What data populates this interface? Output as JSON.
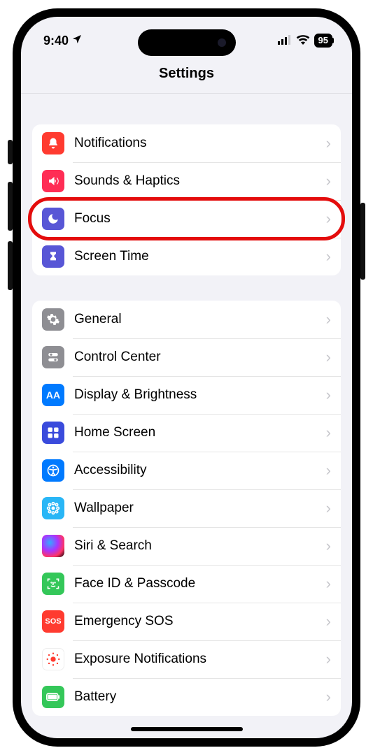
{
  "status": {
    "time": "9:40",
    "battery": "95"
  },
  "header": {
    "title": "Settings"
  },
  "groups": [
    {
      "items": [
        {
          "key": "notifications",
          "label": "Notifications"
        },
        {
          "key": "sounds-haptics",
          "label": "Sounds & Haptics"
        },
        {
          "key": "focus",
          "label": "Focus",
          "highlighted": true
        },
        {
          "key": "screen-time",
          "label": "Screen Time"
        }
      ]
    },
    {
      "items": [
        {
          "key": "general",
          "label": "General"
        },
        {
          "key": "control-center",
          "label": "Control Center"
        },
        {
          "key": "display-brightness",
          "label": "Display & Brightness"
        },
        {
          "key": "home-screen",
          "label": "Home Screen"
        },
        {
          "key": "accessibility",
          "label": "Accessibility"
        },
        {
          "key": "wallpaper",
          "label": "Wallpaper"
        },
        {
          "key": "siri-search",
          "label": "Siri & Search"
        },
        {
          "key": "face-id-passcode",
          "label": "Face ID & Passcode"
        },
        {
          "key": "emergency-sos",
          "label": "Emergency SOS"
        },
        {
          "key": "exposure-notifications",
          "label": "Exposure Notifications"
        },
        {
          "key": "battery",
          "label": "Battery"
        }
      ]
    }
  ],
  "icons": {
    "notifications": {
      "bg": "#ff3b30",
      "glyph": "bell"
    },
    "sounds-haptics": {
      "bg": "#ff2d55",
      "glyph": "speaker"
    },
    "focus": {
      "bg": "#5856d6",
      "glyph": "moon"
    },
    "screen-time": {
      "bg": "#5856d6",
      "glyph": "hourglass"
    },
    "general": {
      "bg": "#8e8e93",
      "glyph": "gear"
    },
    "control-center": {
      "bg": "#8e8e93",
      "glyph": "toggles"
    },
    "display-brightness": {
      "bg": "#007aff",
      "glyph": "AA"
    },
    "home-screen": {
      "bg": "#3355dd",
      "glyph": "grid"
    },
    "accessibility": {
      "bg": "#007aff",
      "glyph": "person"
    },
    "wallpaper": {
      "bg": "#29b6f6",
      "glyph": "flower"
    },
    "siri-search": {
      "bg": "#222",
      "glyph": "siri"
    },
    "face-id-passcode": {
      "bg": "#34c759",
      "glyph": "face"
    },
    "emergency-sos": {
      "bg": "#ff3b30",
      "glyph": "SOS"
    },
    "exposure-notifications": {
      "bg": "#ffffff",
      "glyph": "exposure"
    },
    "battery": {
      "bg": "#34c759",
      "glyph": "battery"
    }
  }
}
